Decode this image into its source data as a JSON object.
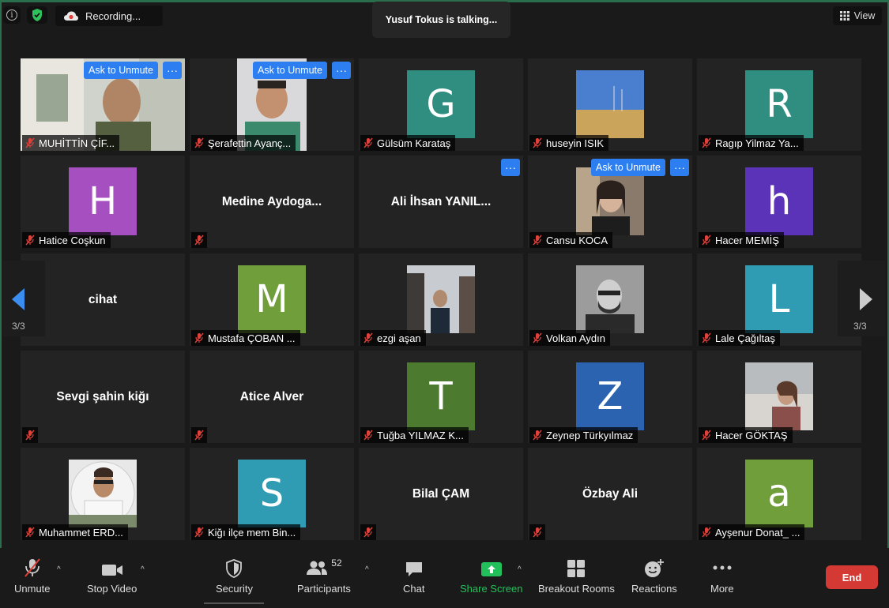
{
  "topbar": {
    "recording_label": "Recording...",
    "talking_label": "Yusuf Tokus is talking...",
    "view_label": "View"
  },
  "tiles": {
    "muhittin": {
      "name": "MUHİTTİN    ÇİF...",
      "ask": "Ask to Unmute"
    },
    "serafettin": {
      "name": "Şerafettin Ayanç...",
      "ask": "Ask to Unmute"
    },
    "gulsum": {
      "name": "Gülsüm Karataş",
      "initial": "G"
    },
    "huseyin": {
      "name": "huseyin ISIK"
    },
    "ragip": {
      "name": "Ragıp Yilmaz  Ya...",
      "initial": "R"
    },
    "hatice": {
      "name": "Hatice Coşkun",
      "initial": "H"
    },
    "medine": {
      "center": "Medine  Aydoga..."
    },
    "ali": {
      "center": "Ali İhsan YANIL..."
    },
    "cansu": {
      "name": "Cansu KOCA",
      "ask": "Ask to Unmute"
    },
    "hacer_m": {
      "name": "Hacer MEMİŞ",
      "initial": "h"
    },
    "cihat": {
      "center": "cihat"
    },
    "mustafa": {
      "name": "Mustafa ÇOBAN ...",
      "initial": "M"
    },
    "ezgi": {
      "name": "ezgi aşan"
    },
    "volkan": {
      "name": "Volkan Aydın"
    },
    "lale": {
      "name": "Lale Çağıltaş",
      "initial": "L"
    },
    "sevgi": {
      "center": "Sevgi şahin kiğı"
    },
    "atice": {
      "center": "Atice Alver"
    },
    "tugba": {
      "name": "Tuğba YILMAZ K...",
      "initial": "T"
    },
    "zeynep": {
      "name": "Zeynep Türkyılmaz",
      "initial": "Z"
    },
    "hacer_g": {
      "name": "Hacer GÖKTAŞ"
    },
    "muhammet": {
      "name": "Muhammet ERD..."
    },
    "kigi": {
      "name": "Kiğı ilçe mem Bin...",
      "initial": "S"
    },
    "bilal": {
      "center": "Bilal ÇAM"
    },
    "ozbay": {
      "center": "Özbay Ali"
    },
    "aysenur": {
      "name": "Ayşenur Donat_ ...",
      "initial": "a"
    }
  },
  "more_label": "···",
  "pagination": {
    "left": "3/3",
    "right": "3/3"
  },
  "toolbar": {
    "unmute": "Unmute",
    "stop_video": "Stop Video",
    "security": "Security",
    "participants": "Participants",
    "participants_count": "52",
    "chat": "Chat",
    "share_screen": "Share Screen",
    "breakout": "Breakout Rooms",
    "reactions": "Reactions",
    "more": "More",
    "end": "End"
  },
  "colors": {
    "ask_button": "#2d7ef0",
    "share_green": "#22c05a",
    "end_red": "#d43a33",
    "avatar_teal": "#2f8e80",
    "avatar_purple": "#a64fc0",
    "avatar_indigo": "#5b33b8",
    "avatar_green": "#6f9e3a",
    "avatar_cyan": "#2f9cb3",
    "avatar_darkgreen": "#4c7a2e",
    "avatar_blue": "#2b63b0"
  }
}
